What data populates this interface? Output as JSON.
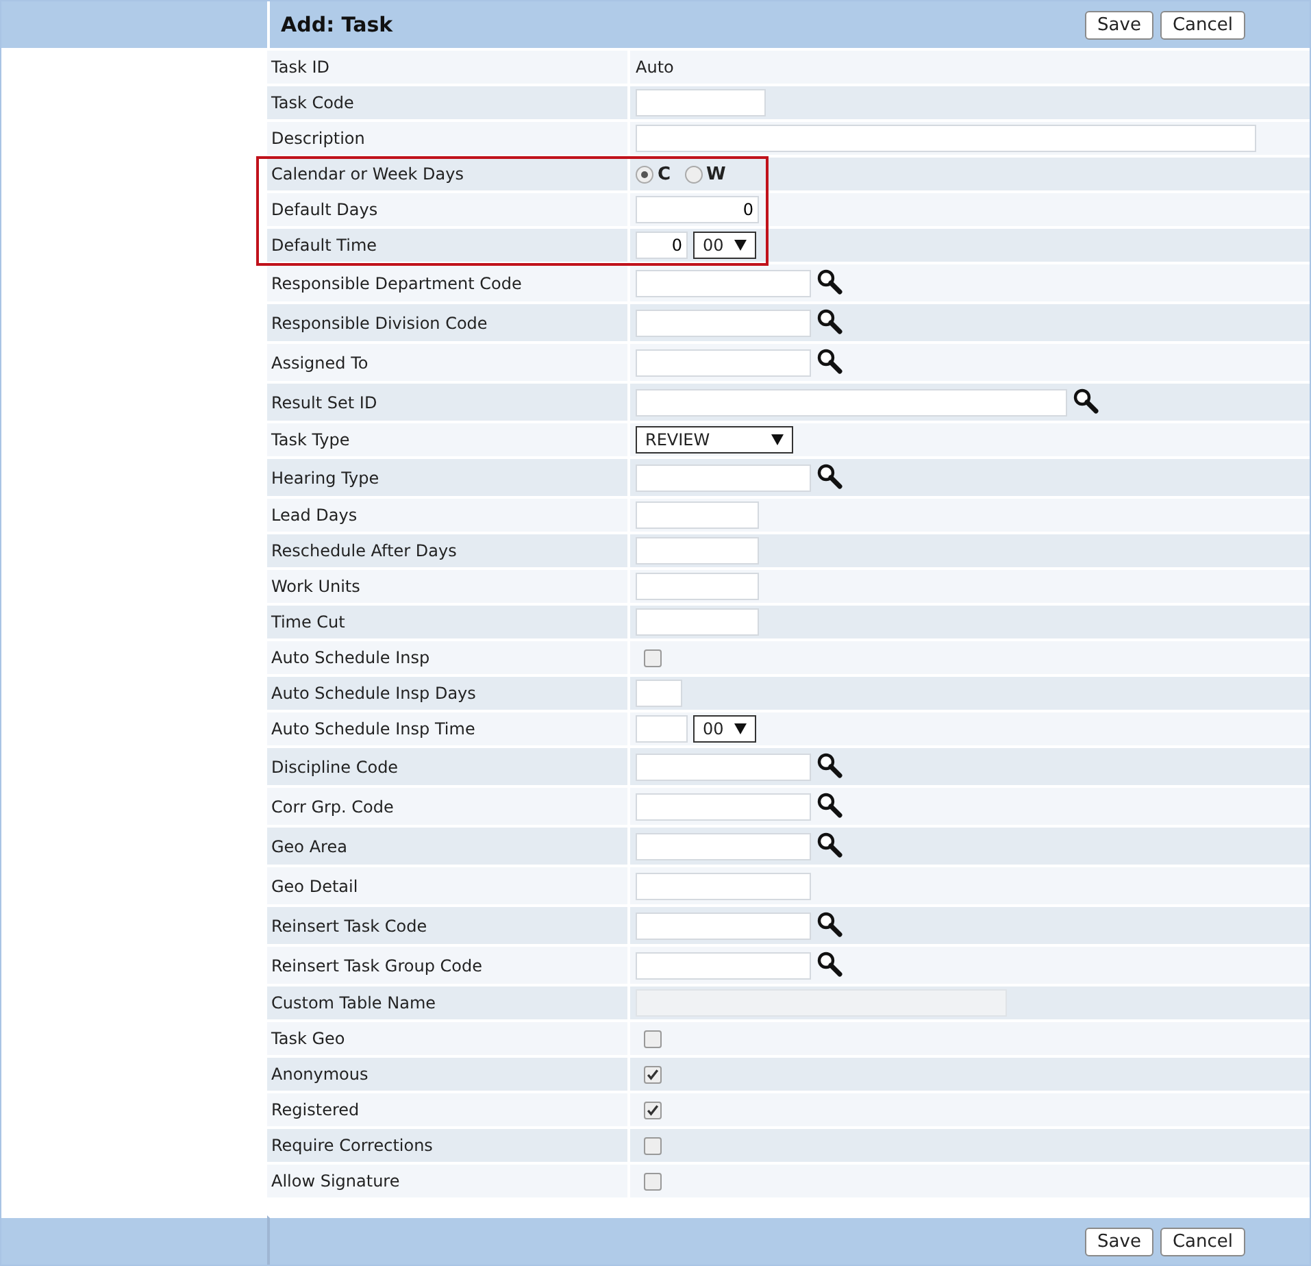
{
  "title": "Add: Task",
  "header_buttons": [
    "Save",
    "Cancel"
  ],
  "rows": [
    {
      "label": "Task ID",
      "kind": "text",
      "value": "Auto",
      "highlighted": false
    },
    {
      "label": "Task Code",
      "kind": "code",
      "highlighted": false
    },
    {
      "label": "Description",
      "kind": "long",
      "highlighted": false
    },
    {
      "label": "Calendar or Week Days",
      "kind": "radio",
      "highlighted": true,
      "options": [
        {
          "label": "C",
          "selected": true
        },
        {
          "label": "W",
          "selected": false
        }
      ]
    },
    {
      "label": "Default Days",
      "kind": "number",
      "value": "0",
      "highlighted": true
    },
    {
      "label": "Default Time",
      "kind": "time",
      "value": "0",
      "option": "00",
      "highlighted": true
    },
    {
      "label": "Responsible Department Code",
      "kind": "lookup",
      "search": true,
      "highlighted": false
    },
    {
      "label": "Responsible Division Code",
      "kind": "lookup",
      "search": true,
      "highlighted": false
    },
    {
      "label": "Assigned To",
      "kind": "lookup",
      "search": true,
      "highlighted": false
    },
    {
      "label": "Result Set ID",
      "kind": "longlookup",
      "search": true,
      "highlighted": false
    },
    {
      "label": "Task Type",
      "kind": "select",
      "option": "REVIEW",
      "highlighted": false
    },
    {
      "label": "Hearing Type",
      "kind": "lookup",
      "search": true,
      "highlighted": false
    },
    {
      "label": "Lead Days",
      "kind": "number",
      "highlighted": false
    },
    {
      "label": "Reschedule After Days",
      "kind": "number",
      "highlighted": false
    },
    {
      "label": "Work Units",
      "kind": "number",
      "highlighted": false
    },
    {
      "label": "Time Cut",
      "kind": "number",
      "highlighted": false
    },
    {
      "label": "Auto Schedule Insp",
      "kind": "checkbox",
      "checked": false,
      "highlighted": false
    },
    {
      "label": "Auto Schedule Insp Days",
      "kind": "days",
      "highlighted": false
    },
    {
      "label": "Auto Schedule Insp Time",
      "kind": "time",
      "option": "00",
      "highlighted": false
    },
    {
      "label": "Discipline Code",
      "kind": "lookup",
      "search": true,
      "highlighted": false
    },
    {
      "label": "Corr Grp. Code",
      "kind": "lookup",
      "search": true,
      "highlighted": false
    },
    {
      "label": "Geo Area",
      "kind": "lookup",
      "search": true,
      "highlighted": false
    },
    {
      "label": "Geo Detail",
      "kind": "lookup",
      "search": false,
      "highlighted": false
    },
    {
      "label": "Reinsert Task Code",
      "kind": "lookup",
      "search": true,
      "highlighted": false
    },
    {
      "label": "Reinsert Task Group Code",
      "kind": "lookup",
      "search": true,
      "highlighted": false
    },
    {
      "label": "Custom Table Name",
      "kind": "readonly",
      "disabled": true,
      "highlighted": false
    },
    {
      "label": "Task Geo",
      "kind": "checkbox",
      "checked": false,
      "highlighted": false
    },
    {
      "label": "Anonymous",
      "kind": "checkbox",
      "checked": true,
      "highlighted": false
    },
    {
      "label": "Registered",
      "kind": "checkbox",
      "checked": true,
      "highlighted": false
    },
    {
      "label": "Require Corrections",
      "kind": "checkbox",
      "checked": false,
      "highlighted": false
    },
    {
      "label": "Allow Signature",
      "kind": "checkbox",
      "checked": false,
      "highlighted": false
    }
  ],
  "footer_buttons": [
    "Save",
    "Cancel"
  ]
}
